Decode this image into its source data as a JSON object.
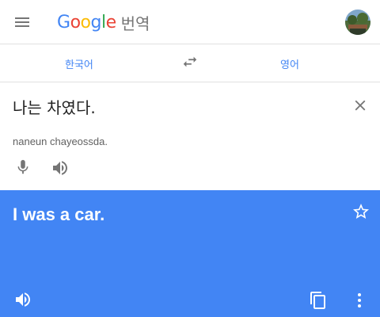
{
  "header": {
    "logo_letters": [
      "G",
      "o",
      "o",
      "g",
      "l",
      "e"
    ],
    "product_name": "번역",
    "menu_icon": "hamburger-menu-icon",
    "avatar_icon": "user-avatar"
  },
  "languages": {
    "source": "한국어",
    "target": "영어",
    "swap_icon": "swap-horiz-icon"
  },
  "source_panel": {
    "text": "나는 차였다.",
    "romanization": "naneun chayeossda.",
    "clear_icon": "close-icon",
    "mic_icon": "microphone-icon",
    "speaker_icon": "volume-icon"
  },
  "result_panel": {
    "text": "I was a car.",
    "star_icon": "star-outline-icon",
    "speaker_icon": "volume-icon",
    "copy_icon": "copy-icon",
    "more_icon": "more-vertical-icon"
  },
  "colors": {
    "accent": "#4285F4",
    "result_bg": "#4285F4",
    "text_primary": "#212121",
    "text_secondary": "#616161",
    "icon_gray": "#757575",
    "divider": "#e0e0e0"
  }
}
